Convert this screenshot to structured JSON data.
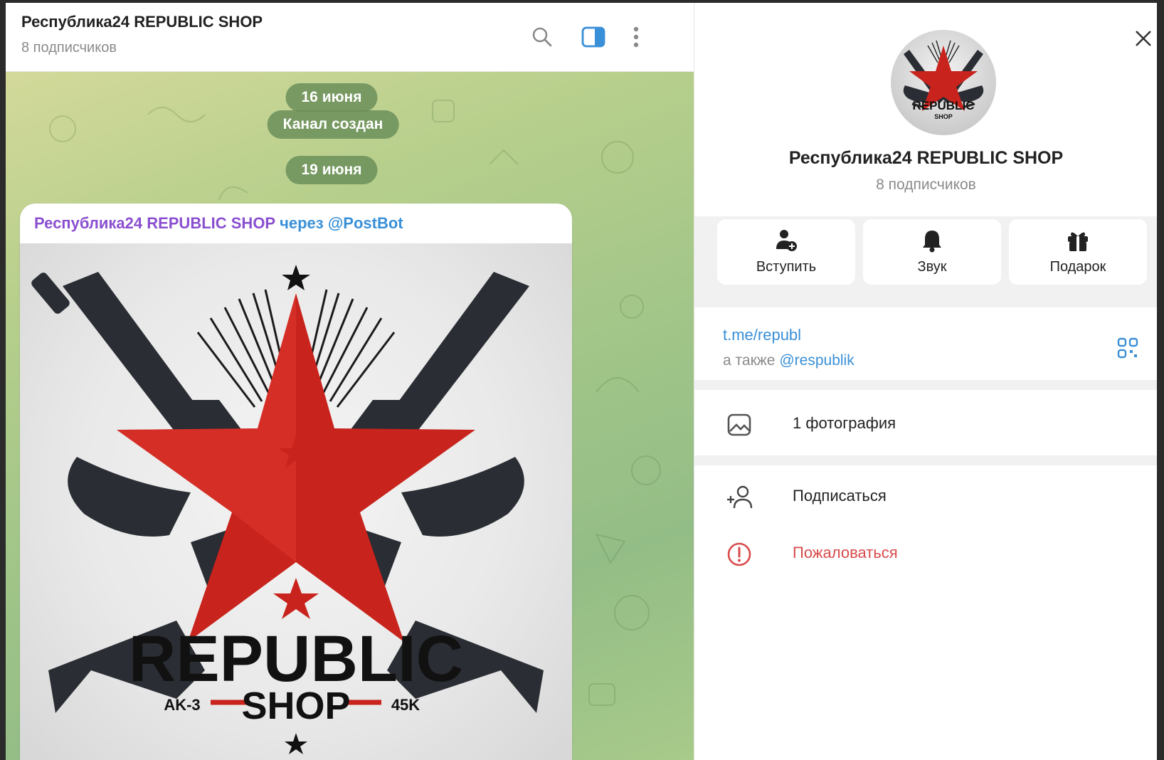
{
  "chat": {
    "title": "Республика24 REPUBLIC SHOP",
    "subtitle": "8 подписчиков",
    "icons": [
      "search-icon",
      "side-panel-icon",
      "more-vertical-icon"
    ],
    "service_messages": [
      {
        "text": "16 июня"
      },
      {
        "text": "Канал создан"
      },
      {
        "text": "19 июня"
      }
    ],
    "post": {
      "channel": "Республика24 REPUBLIC SHOP",
      "via": "через @PostBot",
      "image_text": {
        "main": "REPUBLIC",
        "shop": "SHOP",
        "left": "AK-3",
        "right": "45K"
      }
    }
  },
  "panel": {
    "avatar_text": {
      "main": "REPUBLIC",
      "sub": "SHOP"
    },
    "title": "Республика24 REPUBLIC SHOP",
    "subtitle": "8 подписчиков",
    "actions": [
      {
        "label": "Вступить",
        "icon": "add-user-icon"
      },
      {
        "label": "Звук",
        "icon": "bell-icon"
      },
      {
        "label": "Подарок",
        "icon": "gift-icon"
      }
    ],
    "link": "t.me/republ",
    "also_prefix": "а также",
    "also_handle": "@respublik",
    "media_row": {
      "label": "1 фотография",
      "icon": "photo-icon"
    },
    "subscribe_row": {
      "label": "Подписаться",
      "icon": "add-person-icon"
    },
    "report_row": {
      "label": "Пожаловаться",
      "icon": "report-icon"
    }
  },
  "colors": {
    "accent": "#3a8fd6",
    "author": "#8a4fd0",
    "danger": "#d94b4b",
    "pill": "#688c58"
  }
}
